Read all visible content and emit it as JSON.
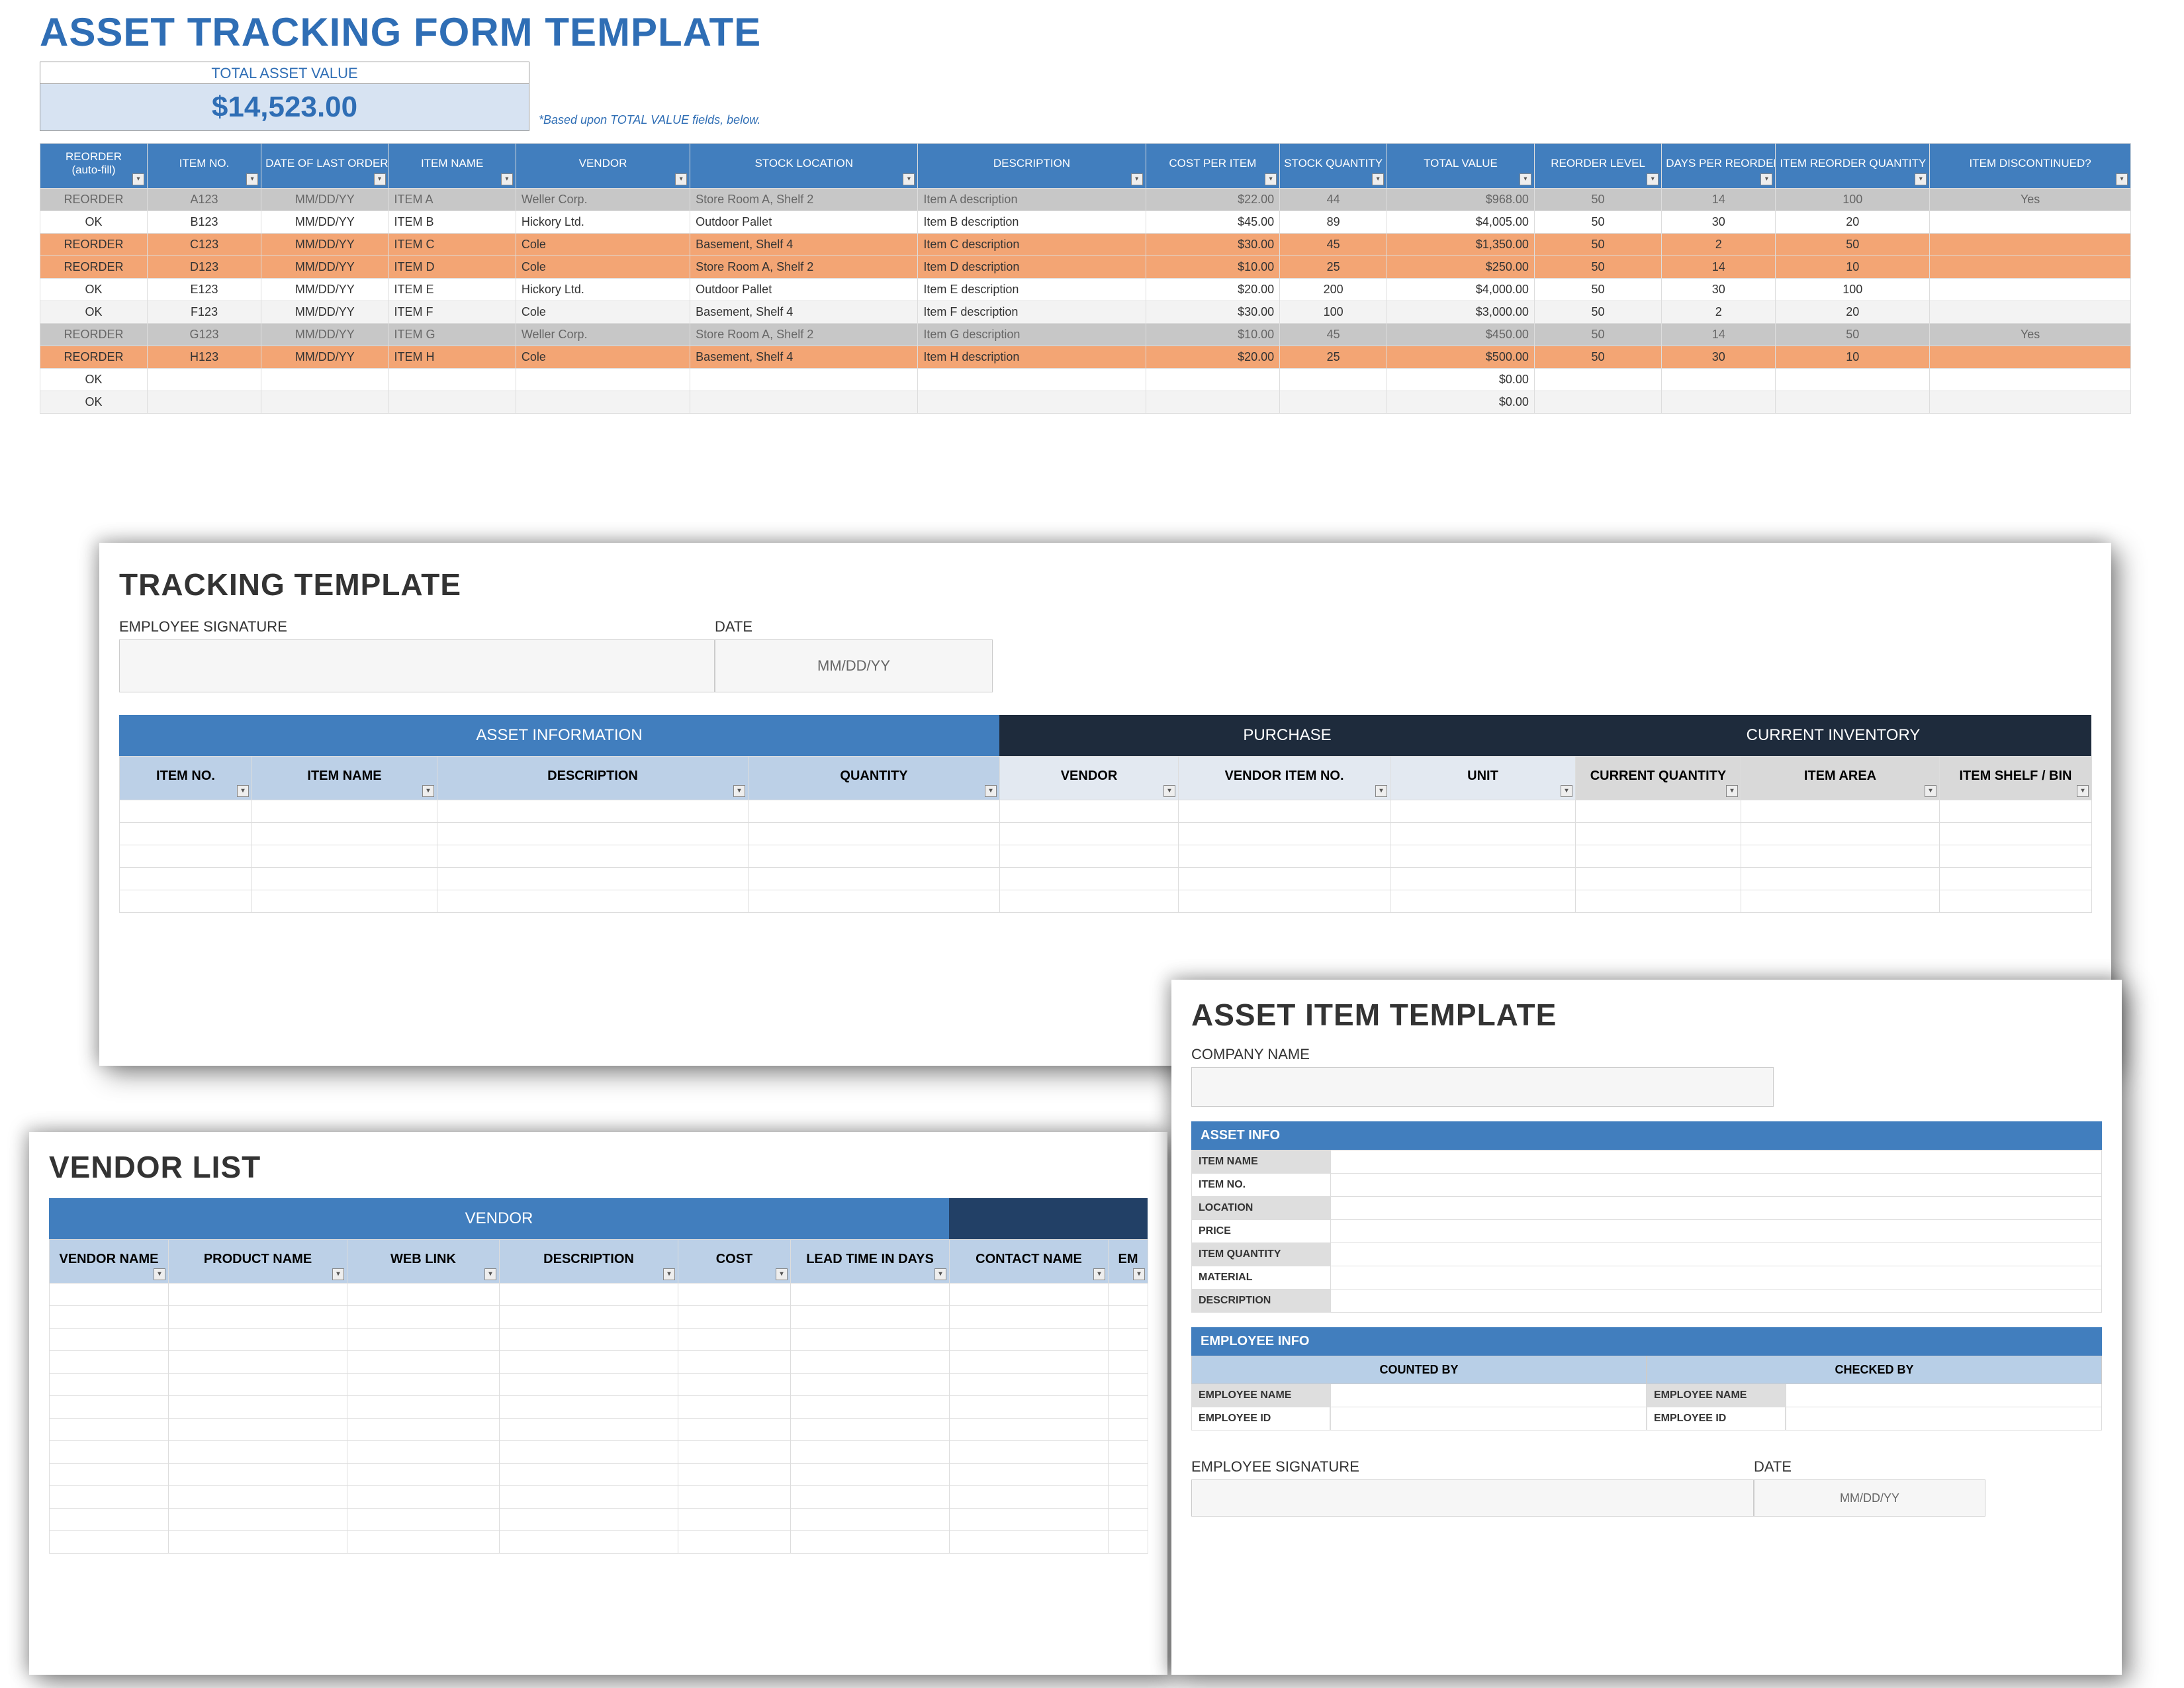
{
  "main": {
    "title": "ASSET TRACKING FORM TEMPLATE",
    "total_caption": "TOTAL ASSET VALUE",
    "total_value": "$14,523.00",
    "total_note": "*Based upon TOTAL VALUE fields, below.",
    "columns": [
      "REORDER (auto-fill)",
      "ITEM NO.",
      "DATE OF LAST ORDER",
      "ITEM NAME",
      "VENDOR",
      "STOCK LOCATION",
      "DESCRIPTION",
      "COST PER ITEM",
      "STOCK QUANTITY",
      "TOTAL VALUE",
      "REORDER LEVEL",
      "DAYS PER REORDER",
      "ITEM REORDER QUANTITY",
      "ITEM DISCONTINUED?"
    ],
    "rows": [
      {
        "state": "gray",
        "c": [
          "REORDER",
          "A123",
          "MM/DD/YY",
          "ITEM A",
          "Weller Corp.",
          "Store Room A, Shelf 2",
          "Item A description",
          "$22.00",
          "44",
          "$968.00",
          "50",
          "14",
          "100",
          "Yes"
        ]
      },
      {
        "state": "white",
        "c": [
          "OK",
          "B123",
          "MM/DD/YY",
          "ITEM B",
          "Hickory Ltd.",
          "Outdoor Pallet",
          "Item B description",
          "$45.00",
          "89",
          "$4,005.00",
          "50",
          "30",
          "20",
          ""
        ]
      },
      {
        "state": "orange",
        "c": [
          "REORDER",
          "C123",
          "MM/DD/YY",
          "ITEM C",
          "Cole",
          "Basement, Shelf 4",
          "Item C description",
          "$30.00",
          "45",
          "$1,350.00",
          "50",
          "2",
          "50",
          ""
        ]
      },
      {
        "state": "orange",
        "c": [
          "REORDER",
          "D123",
          "MM/DD/YY",
          "ITEM D",
          "Cole",
          "Store Room A, Shelf 2",
          "Item D description",
          "$10.00",
          "25",
          "$250.00",
          "50",
          "14",
          "10",
          ""
        ]
      },
      {
        "state": "white",
        "c": [
          "OK",
          "E123",
          "MM/DD/YY",
          "ITEM E",
          "Hickory Ltd.",
          "Outdoor Pallet",
          "Item E description",
          "$20.00",
          "200",
          "$4,000.00",
          "50",
          "30",
          "100",
          ""
        ]
      },
      {
        "state": "lgray",
        "c": [
          "OK",
          "F123",
          "MM/DD/YY",
          "ITEM F",
          "Cole",
          "Basement, Shelf 4",
          "Item F description",
          "$30.00",
          "100",
          "$3,000.00",
          "50",
          "2",
          "20",
          ""
        ]
      },
      {
        "state": "gray",
        "c": [
          "REORDER",
          "G123",
          "MM/DD/YY",
          "ITEM G",
          "Weller Corp.",
          "Store Room A, Shelf 2",
          "Item G description",
          "$10.00",
          "45",
          "$450.00",
          "50",
          "14",
          "50",
          "Yes"
        ]
      },
      {
        "state": "orange",
        "c": [
          "REORDER",
          "H123",
          "MM/DD/YY",
          "ITEM H",
          "Cole",
          "Basement, Shelf 4",
          "Item H description",
          "$20.00",
          "25",
          "$500.00",
          "50",
          "30",
          "10",
          ""
        ]
      },
      {
        "state": "white",
        "c": [
          "OK",
          "",
          "",
          "",
          "",
          "",
          "",
          "",
          "",
          "$0.00",
          "",
          "",
          "",
          ""
        ]
      },
      {
        "state": "lgray",
        "c": [
          "OK",
          "",
          "",
          "",
          "",
          "",
          "",
          "",
          "",
          "$0.00",
          "",
          "",
          "",
          ""
        ]
      }
    ]
  },
  "tracking": {
    "title": "TRACKING TEMPLATE",
    "sig_label": "EMPLOYEE SIGNATURE",
    "date_label": "DATE",
    "date_value": "MM/DD/YY",
    "sections": [
      "ASSET INFORMATION",
      "PURCHASE",
      "CURRENT INVENTORY"
    ],
    "cols_a": [
      "ITEM NO.",
      "ITEM NAME",
      "DESCRIPTION",
      "QUANTITY"
    ],
    "cols_b": [
      "VENDOR",
      "VENDOR ITEM NO.",
      "UNIT"
    ],
    "cols_c": [
      "CURRENT QUANTITY",
      "ITEM AREA",
      "ITEM SHELF / BIN"
    ]
  },
  "vendor": {
    "title": "VENDOR LIST",
    "section": "VENDOR",
    "cols": [
      "VENDOR NAME",
      "PRODUCT NAME",
      "WEB LINK",
      "DESCRIPTION",
      "COST",
      "LEAD TIME IN DAYS",
      "CONTACT NAME",
      "EM"
    ]
  },
  "item": {
    "title": "ASSET ITEM TEMPLATE",
    "company_label": "COMPANY NAME",
    "band_asset": "ASSET INFO",
    "fields": [
      "ITEM NAME",
      "ITEM NO.",
      "LOCATION",
      "PRICE",
      "ITEM QUANTITY",
      "MATERIAL",
      "DESCRIPTION"
    ],
    "band_emp": "EMPLOYEE INFO",
    "emp_sub": [
      "COUNTED BY",
      "CHECKED BY"
    ],
    "emp_rows": [
      "EMPLOYEE NAME",
      "EMPLOYEE ID"
    ],
    "sig_label": "EMPLOYEE SIGNATURE",
    "date_label": "DATE",
    "date_value": "MM/DD/YY"
  }
}
